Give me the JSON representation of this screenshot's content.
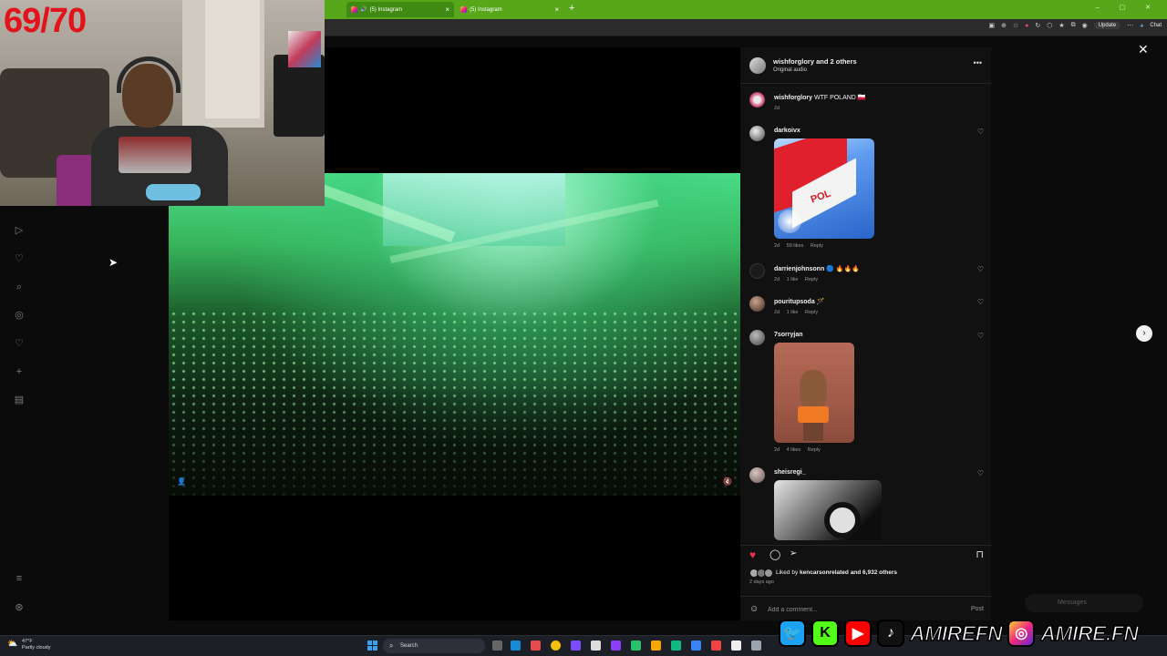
{
  "stream_overlay": {
    "counter": "69/70"
  },
  "browser": {
    "tabs": [
      {
        "label": "(5) Instagram",
        "active": true
      },
      {
        "label": "(5) Instagram",
        "active": false
      }
    ],
    "update_label": "Update",
    "chat_label": "Chat"
  },
  "post": {
    "author": "wishforglory",
    "header_title": "wishforglory and 2 others",
    "audio": "Original audio",
    "caption_user": "wishforglory",
    "caption_text": "WTF POLAND 🇵🇱",
    "caption_time": "2d",
    "comments": [
      {
        "user": "darkoivx",
        "text": "",
        "time": "2d",
        "likes": "59 likes",
        "reply": "Reply"
      },
      {
        "user": "darrienjohnsonn",
        "text": "🔵 🔥🔥🔥",
        "time": "2d",
        "likes": "1 like",
        "reply": "Reply"
      },
      {
        "user": "pouritupsoda",
        "text": "🪄",
        "time": "2d",
        "likes": "1 like",
        "reply": "Reply"
      },
      {
        "user": "7sorryjan",
        "text": "",
        "time": "2d",
        "likes": "4 likes",
        "reply": "Reply"
      },
      {
        "user": "sheisregi_",
        "text": "",
        "time": "",
        "likes": "",
        "reply": ""
      }
    ],
    "flag_word": "POL",
    "liked_by_prefix": "Liked by",
    "liked_by_user": "kencarsonrelated",
    "liked_by_rest": "and 6,932 others",
    "posted_ago": "2 days ago",
    "comment_placeholder": "Add a comment...",
    "post_label": "Post"
  },
  "messages_label": "Messages",
  "taskbar": {
    "temperature": "47°F",
    "weather": "Partly cloudy",
    "search_label": "Search"
  },
  "social": {
    "handle_1": "AMIREFN",
    "handle_2": "AMIRE.FN"
  },
  "icons": {
    "like": "heart-filled-icon",
    "comment": "comment-bubble-icon",
    "share": "paper-plane-icon",
    "save": "bookmark-icon",
    "close": "close-icon",
    "next": "chevron-right-icon"
  },
  "colors": {
    "browser_accent": "#58a61a",
    "like_red": "#ed2f47",
    "counter_red": "#e2131a",
    "panel_bg": "#111111"
  }
}
